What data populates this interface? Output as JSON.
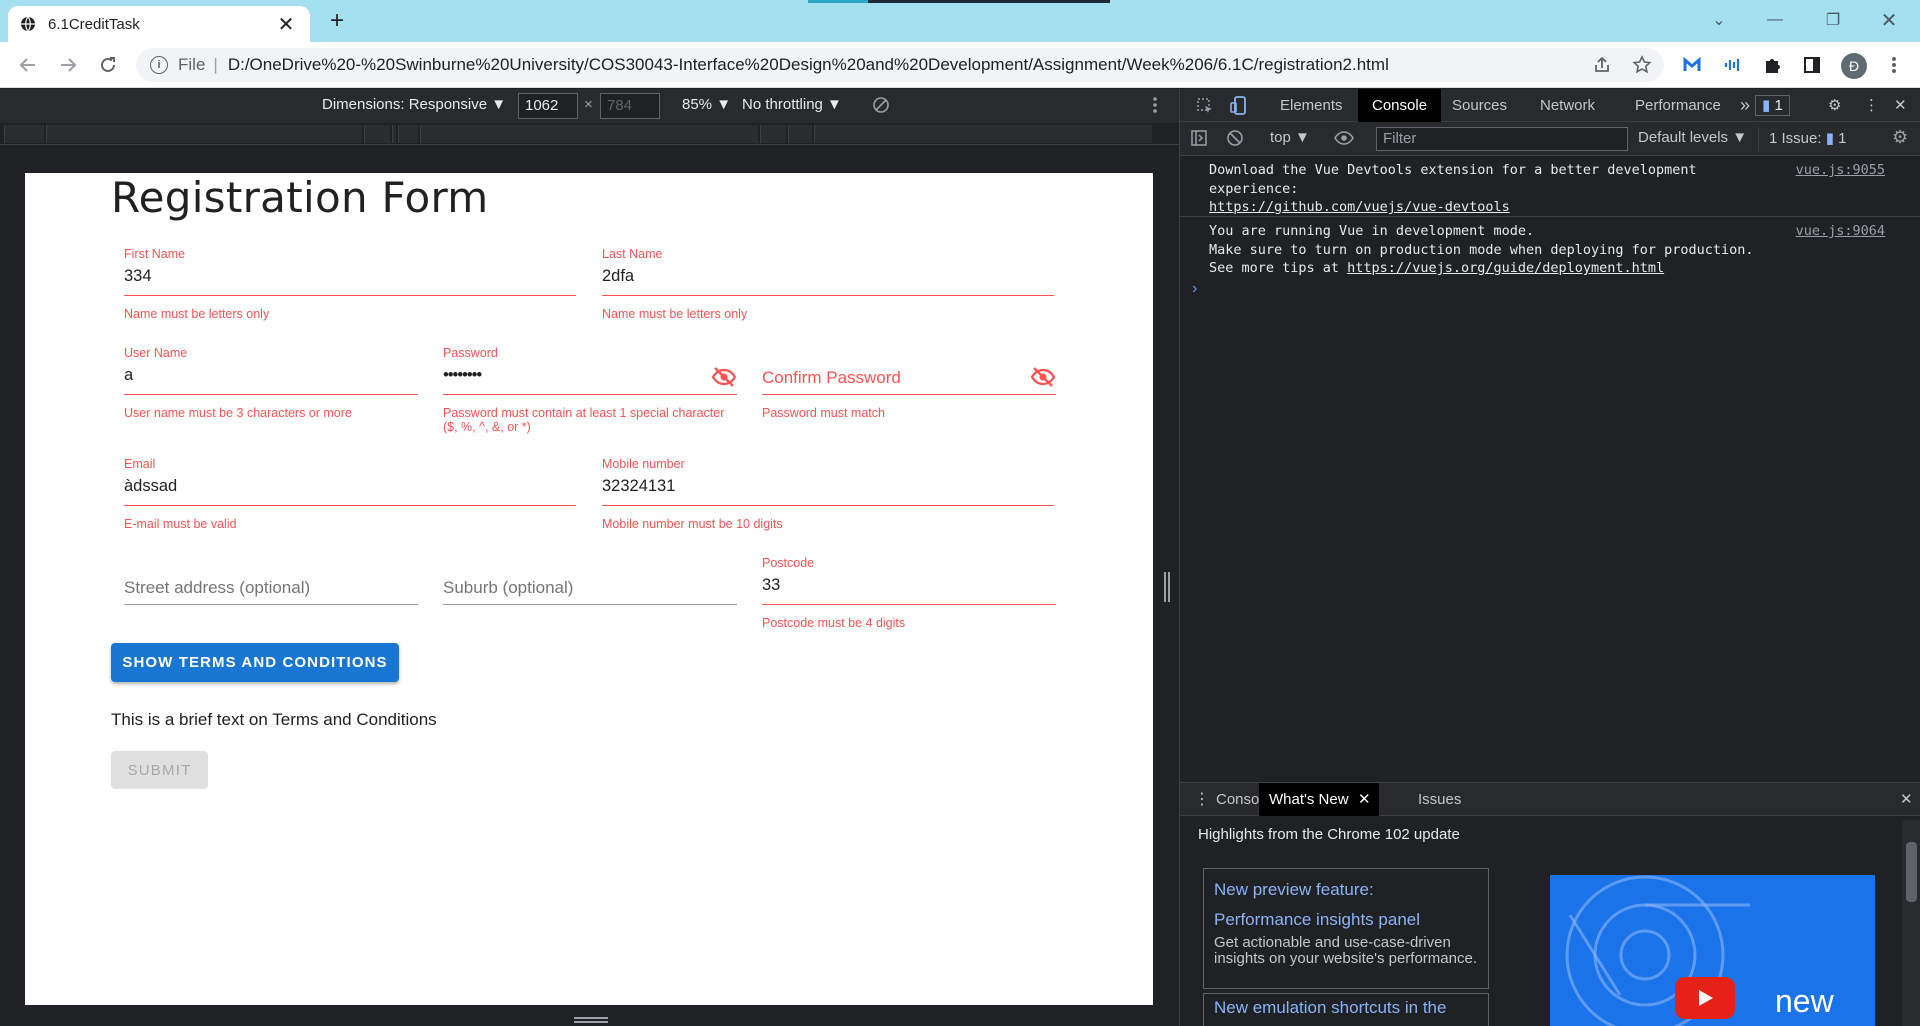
{
  "browser": {
    "tab_title": "6.1CreditTask",
    "url_scheme": "File",
    "url": "D:/OneDrive%20-%20Swinburne%20University/COS30043-Interface%20Design%20and%20Development/Assignment/Week%206/6.1C/registration2.html",
    "avatar_letter": "Đ"
  },
  "device_toolbar": {
    "dimensions_label": "Dimensions: Responsive ▼",
    "width": "1062",
    "height": "784",
    "zoom": "85% ▼",
    "throttling": "No throttling ▼"
  },
  "form": {
    "title": "Registration Form",
    "first_name": {
      "label": "First Name",
      "value": "334",
      "error": "Name must be letters only"
    },
    "last_name": {
      "label": "Last Name",
      "value": "2dfa",
      "error": "Name must be letters only"
    },
    "user_name": {
      "label": "User Name",
      "value": "a",
      "error": "User name must be 3 characters or more"
    },
    "password": {
      "label": "Password",
      "value": "••••••••",
      "error": "Password must contain at least 1 special character ($, %, ^, &, or *)"
    },
    "confirm_password": {
      "placeholder": "Confirm Password",
      "error": "Password must match"
    },
    "email": {
      "label": "Email",
      "value": "àdssad",
      "error": "E-mail must be valid"
    },
    "mobile": {
      "label": "Mobile number",
      "value": "32324131",
      "error": "Mobile number must be 10 digits"
    },
    "street": {
      "placeholder": "Street address (optional)"
    },
    "suburb": {
      "placeholder": "Suburb (optional)"
    },
    "postcode": {
      "label": "Postcode",
      "value": "33",
      "error": "Postcode must be 4 digits"
    },
    "terms_button": "SHOW TERMS AND CONDITIONS",
    "terms_text": "This is a brief text on Terms and Conditions",
    "submit_button": "SUBMIT"
  },
  "devtools": {
    "tabs": [
      "Elements",
      "Console",
      "Sources",
      "Network",
      "Performance"
    ],
    "more": "»",
    "issues_badge": "1",
    "context": "top ▼",
    "filter_placeholder": "Filter",
    "levels": "Default levels ▼",
    "issues_count": "1 Issue:",
    "issues_num": "1",
    "messages": [
      {
        "line1": "Download the Vue Devtools extension for a better development",
        "line2": "experience:",
        "link": "https://github.com/vuejs/vue-devtools",
        "source": "vue.js:9055"
      },
      {
        "line1": "You are running Vue in development mode.",
        "line2": "Make sure to turn on production mode when deploying for production.",
        "line3_prefix": "See more tips at ",
        "link": "https://vuejs.org/guide/deployment.html",
        "source": "vue.js:9064"
      }
    ],
    "drawer_tabs": [
      "Console",
      "What's New",
      "Issues"
    ],
    "highlights": "Highlights from the Chrome 102 update",
    "card1_title_a": "New preview feature:",
    "card1_title_b": "Performance insights panel",
    "card1_desc": "Get actionable and use-case-driven insights on your website's performance.",
    "card2_title": "New emulation shortcuts in the",
    "thumb_text": "new"
  },
  "colors": {
    "error": "#ff5252",
    "primary": "#1976d2",
    "devtools_bg": "#202124",
    "tabstrip": "#a5e0f0"
  }
}
